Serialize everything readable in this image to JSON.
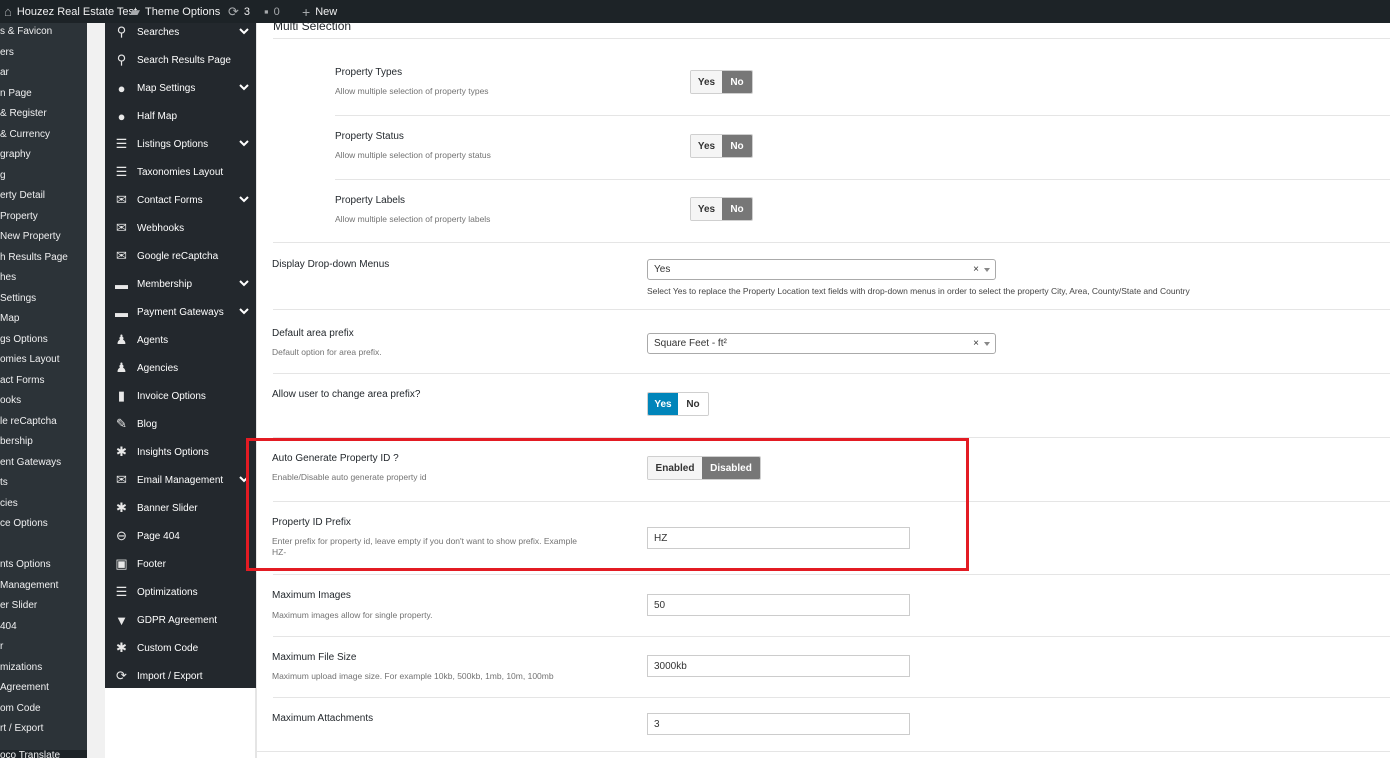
{
  "admin_bar": {
    "site_name": "Houzez Real Estate Test",
    "theme_options": "Theme Options",
    "updates_count": "3",
    "comments_count": "0",
    "new_label": "New"
  },
  "wp_menu": [
    "s & Favicon",
    "ers",
    "ar",
    "n Page",
    "& Register",
    "& Currency",
    "graphy",
    "g",
    "erty Detail",
    "Property",
    "New Property",
    "h Results Page",
    "hes",
    "Settings",
    "Map",
    "gs Options",
    "omies Layout",
    "act Forms",
    "ooks",
    "le reCaptcha",
    "bership",
    "ent Gateways",
    "ts",
    "cies",
    "ce Options",
    "",
    "nts Options",
    "Management",
    "er Slider",
    "404",
    "r",
    "mizations",
    "Agreement",
    "om Code",
    "rt / Export"
  ],
  "wp_menu_bottom": "oco Translate",
  "options_nav": [
    {
      "label": "Searches",
      "icon": "search-icon",
      "chevron": true
    },
    {
      "label": "Search Results Page",
      "icon": "search-icon",
      "chevron": false
    },
    {
      "label": "Map Settings",
      "icon": "globe-icon",
      "chevron": true
    },
    {
      "label": "Half Map",
      "icon": "globe-icon",
      "chevron": false
    },
    {
      "label": "Listings Options",
      "icon": "list-icon",
      "chevron": true
    },
    {
      "label": "Taxonomies Layout",
      "icon": "list-icon",
      "chevron": false
    },
    {
      "label": "Contact Forms",
      "icon": "envelope-icon",
      "chevron": true
    },
    {
      "label": "Webhooks",
      "icon": "envelope-icon",
      "chevron": false
    },
    {
      "label": "Google reCaptcha",
      "icon": "envelope-icon",
      "chevron": false
    },
    {
      "label": "Membership",
      "icon": "card-icon",
      "chevron": true
    },
    {
      "label": "Payment Gateways",
      "icon": "card-icon",
      "chevron": true
    },
    {
      "label": "Agents",
      "icon": "user-icon",
      "chevron": false
    },
    {
      "label": "Agencies",
      "icon": "user-icon",
      "chevron": false
    },
    {
      "label": "Invoice Options",
      "icon": "document-icon",
      "chevron": false
    },
    {
      "label": "Blog",
      "icon": "edit-icon",
      "chevron": false
    },
    {
      "label": "Insights Options",
      "icon": "gear-icon",
      "chevron": false
    },
    {
      "label": "Email Management",
      "icon": "envelope-icon",
      "chevron": true
    },
    {
      "label": "Banner Slider",
      "icon": "gear-icon",
      "chevron": false
    },
    {
      "label": "Page 404",
      "icon": "minus-circle-icon",
      "chevron": false
    },
    {
      "label": "Footer",
      "icon": "footer-icon",
      "chevron": false
    },
    {
      "label": "Optimizations",
      "icon": "list-icon",
      "chevron": false
    },
    {
      "label": "GDPR Agreement",
      "icon": "bookmark-icon",
      "chevron": false
    },
    {
      "label": "Custom Code",
      "icon": "gear-icon",
      "chevron": false
    },
    {
      "label": "Import / Export",
      "icon": "refresh-icon",
      "chevron": false
    }
  ],
  "section_title": "Multi Selection",
  "multi": [
    {
      "title": "Property Types",
      "subtitle": "Allow multiple selection of property types",
      "yes": "Yes",
      "no": "No"
    },
    {
      "title": "Property Status",
      "subtitle": "Allow multiple selection of property status",
      "yes": "Yes",
      "no": "No"
    },
    {
      "title": "Property Labels",
      "subtitle": "Allow multiple selection of property labels",
      "yes": "Yes",
      "no": "No"
    }
  ],
  "dropdown_menus": {
    "title": "Display Drop-down Menus",
    "value": "Yes",
    "clear": "×",
    "description": "Select Yes to replace the Property Location text fields with drop-down menus in order to select the property City, Area, County/State and Country"
  },
  "area_prefix": {
    "title": "Default area prefix",
    "subtitle": "Default option for area prefix.",
    "value": "Square Feet - ft²",
    "clear": "×"
  },
  "change_prefix": {
    "title": "Allow user to change area prefix?",
    "yes": "Yes",
    "no": "No"
  },
  "auto_id": {
    "title": "Auto Generate Property ID ?",
    "subtitle": "Enable/Disable auto generate property id",
    "enabled": "Enabled",
    "disabled": "Disabled"
  },
  "id_prefix": {
    "title": "Property ID Prefix",
    "subtitle_line1": "Enter prefix for property id, leave empty if you don't want to show prefix. Example",
    "subtitle_line2": "HZ-",
    "value": "HZ"
  },
  "max_images": {
    "title": "Maximum Images",
    "subtitle": "Maximum images allow for single property.",
    "value": "50"
  },
  "max_file_size": {
    "title": "Maximum File Size",
    "subtitle": "Maximum upload image size. For example 10kb, 500kb, 1mb, 10m, 100mb",
    "value": "3000kb"
  },
  "max_attachments": {
    "title": "Maximum Attachments",
    "value": "3"
  },
  "colors": {
    "highlight": "#e31b23",
    "toggle_active_blue": "#0085ba",
    "toggle_active_gray": "#777777",
    "sidebar": "#23282d"
  }
}
